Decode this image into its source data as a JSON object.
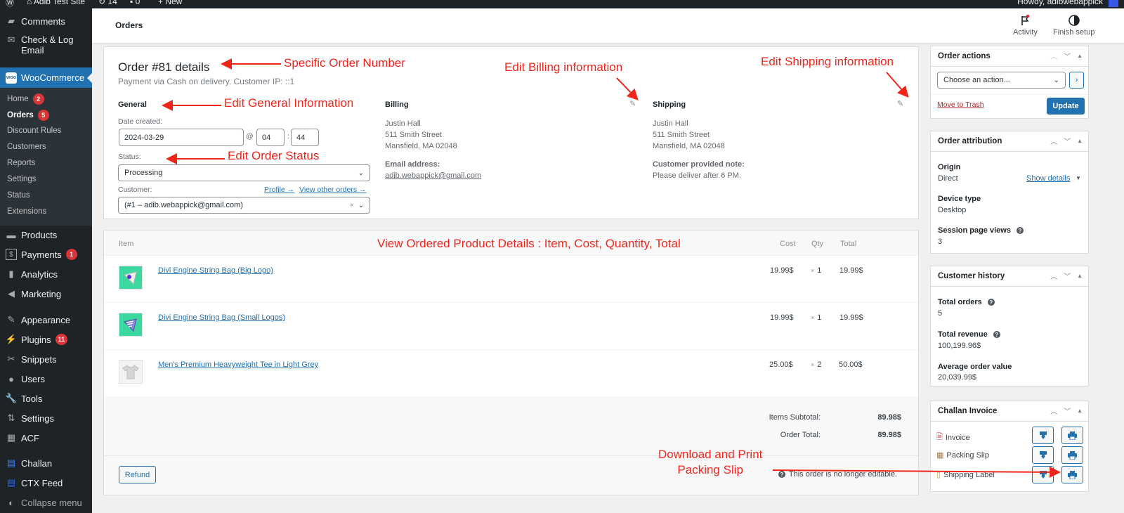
{
  "admin_bar": {
    "site_name": "Adib Test Site",
    "updates_count": "14",
    "comments_count": "0",
    "new_label": "New",
    "howdy": "Howdy, adibwebappick"
  },
  "sidebar": {
    "top_items": [
      {
        "label": "Comments",
        "icon": "comment-icon"
      },
      {
        "label": "Check & Log Email",
        "icon": "envelope-icon"
      }
    ],
    "woocommerce_label": "WooCommerce",
    "submenu": [
      {
        "label": "Home",
        "badge": "2"
      },
      {
        "label": "Orders",
        "badge": "5",
        "current": true
      },
      {
        "label": "Discount Rules"
      },
      {
        "label": "Customers"
      },
      {
        "label": "Reports"
      },
      {
        "label": "Settings"
      },
      {
        "label": "Status"
      },
      {
        "label": "Extensions"
      }
    ],
    "items": [
      {
        "label": "Products",
        "icon": "archive-icon"
      },
      {
        "label": "Payments",
        "icon": "dollar-icon",
        "badge": "1"
      },
      {
        "label": "Analytics",
        "icon": "bar-chart-icon"
      },
      {
        "label": "Marketing",
        "icon": "megaphone-icon"
      },
      {
        "label": "Appearance",
        "icon": "brush-icon"
      },
      {
        "label": "Plugins",
        "icon": "plug-icon",
        "badge": "11"
      },
      {
        "label": "Snippets",
        "icon": "scissors-icon"
      },
      {
        "label": "Users",
        "icon": "user-icon"
      },
      {
        "label": "Tools",
        "icon": "wrench-icon"
      },
      {
        "label": "Settings",
        "icon": "sliders-icon"
      },
      {
        "label": "ACF",
        "icon": "grid-icon"
      },
      {
        "label": "Challan",
        "icon": "document-stack-icon"
      },
      {
        "label": "CTX Feed",
        "icon": "document-icon"
      }
    ],
    "collapse_label": "Collapse menu"
  },
  "header": {
    "title": "Orders",
    "activity_label": "Activity",
    "finish_setup_label": "Finish setup"
  },
  "order": {
    "title": "Order #81 details",
    "subtitle": "Payment via Cash on delivery. Customer IP: ::1",
    "general": {
      "heading": "General",
      "date_label": "Date created:",
      "date_value": "2024-03-29",
      "at": "@",
      "hour": "04",
      "colon": ":",
      "minute": "44",
      "status_label": "Status:",
      "status_value": "Processing",
      "customer_label": "Customer:",
      "profile_link": "Profile →",
      "view_orders_link": "View other orders →",
      "customer_value": "(#1 – adib.webappick@gmail.com)",
      "clear": "×"
    },
    "billing": {
      "heading": "Billing",
      "name": "Justin Hall",
      "street": "511 Smith Street",
      "city": "Mansfield, MA 02048",
      "email_label": "Email address:",
      "email": "adib.webappick@gmail.com"
    },
    "shipping": {
      "heading": "Shipping",
      "name": "Justin Hall",
      "street": "511 Smith Street",
      "city": "Mansfield, MA 02048",
      "note_label": "Customer provided note:",
      "note": "Please deliver after 6 PM."
    }
  },
  "items": {
    "headers": {
      "item": "Item",
      "cost": "Cost",
      "qty": "Qty",
      "total": "Total"
    },
    "rows": [
      {
        "name": "Divi Engine String Bag (Big Logo)",
        "cost": "19.99$",
        "qty": "1",
        "total": "19.99$",
        "thumb": "bag-big-logo"
      },
      {
        "name": "Divi Engine String Bag (Small Logos)",
        "cost": "19.99$",
        "qty": "1",
        "total": "19.99$",
        "thumb": "bag-small-logos"
      },
      {
        "name": "Men's Premium Heavyweight Tee in Light Grey",
        "cost": "25.00$",
        "qty": "2",
        "total": "50.00$",
        "thumb": "tee"
      }
    ],
    "qty_prefix": "×",
    "subtotal_label": "Items Subtotal:",
    "subtotal_value": "89.98$",
    "order_total_label": "Order Total:",
    "order_total_value": "89.98$",
    "refund_label": "Refund",
    "not_editable": "This order is no longer editable."
  },
  "order_actions": {
    "title": "Order actions",
    "select_placeholder": "Choose an action...",
    "go": "›",
    "trash_label": "Move to Trash",
    "update_label": "Update"
  },
  "order_attribution": {
    "title": "Order attribution",
    "origin_label": "Origin",
    "origin_value": "Direct",
    "show_details": "Show details",
    "device_label": "Device type",
    "device_value": "Desktop",
    "session_label": "Session page views",
    "session_value": "3"
  },
  "customer_history": {
    "title": "Customer history",
    "total_orders_label": "Total orders",
    "total_orders_value": "5",
    "total_revenue_label": "Total revenue",
    "total_revenue_value": "100,199.96$",
    "aov_label": "Average order value",
    "aov_value": "20,039.99$"
  },
  "challan": {
    "title": "Challan Invoice",
    "rows": [
      {
        "label": "Invoice"
      },
      {
        "label": "Packing Slip"
      },
      {
        "label": "Shipping Label"
      }
    ]
  },
  "annotations": {
    "order_number": "Specific Order Number",
    "general_info": "Edit General Information",
    "order_status": "Edit Order  Status",
    "billing": "Edit Billing information",
    "shipping": "Edit Shipping information",
    "products": "View Ordered Product Details : Item, Cost, Quantity, Total",
    "packing_line1": "Download and Print",
    "packing_line2": "Packing Slip",
    "color": "#f0261b"
  },
  "colors": {
    "accent": "#2271b1",
    "sidebar_bg": "#1d2327",
    "badge": "#d63638",
    "trash": "#b32d2e"
  }
}
